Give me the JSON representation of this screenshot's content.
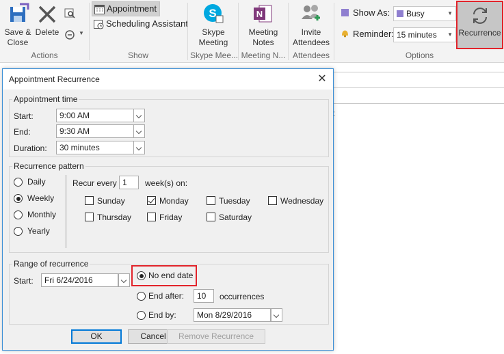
{
  "ribbon": {
    "actions": {
      "save_close": [
        "Save &",
        "Close"
      ],
      "delete": "Delete",
      "group_label": "Actions"
    },
    "show": {
      "appointment": "Appointment",
      "scheduling": "Scheduling Assistant",
      "group_label": "Show"
    },
    "skype": {
      "label": [
        "Skype",
        "Meeting"
      ],
      "group_label": "Skype Mee..."
    },
    "notes": {
      "label": [
        "Meeting",
        "Notes"
      ],
      "group_label": "Meeting N..."
    },
    "attendees": {
      "label": [
        "Invite",
        "Attendees"
      ],
      "group_label": "Attendees"
    },
    "options": {
      "show_as_label": "Show As:",
      "show_as_value": "Busy",
      "reminder_label": "Reminder:",
      "reminder_value": "15 minutes",
      "recurrence": "Recurrence",
      "group_label": "Options"
    }
  },
  "background": {
    "partial_text": "t"
  },
  "dialog": {
    "title": "Appointment Recurrence",
    "appointment_time": {
      "legend": "Appointment time",
      "start_label": "Start:",
      "start_value": "9:00 AM",
      "end_label": "End:",
      "end_value": "9:30 AM",
      "duration_label": "Duration:",
      "duration_value": "30 minutes"
    },
    "pattern": {
      "legend": "Recurrence pattern",
      "options": [
        "Daily",
        "Weekly",
        "Monthly",
        "Yearly"
      ],
      "selected": "Weekly",
      "recur_every_label": "Recur every",
      "recur_every_value": "1",
      "weeks_on_label": "week(s) on:",
      "days": [
        "Sunday",
        "Monday",
        "Tuesday",
        "Wednesday",
        "Thursday",
        "Friday",
        "Saturday"
      ],
      "checked_days": [
        "Monday"
      ]
    },
    "range": {
      "legend": "Range of recurrence",
      "start_label": "Start:",
      "start_value": "Fri 6/24/2016",
      "no_end": "No end date",
      "end_after": "End after:",
      "end_after_value": "10",
      "occurrences": "occurrences",
      "end_by": "End by:",
      "end_by_value": "Mon 8/29/2016",
      "selected": "No end date"
    },
    "buttons": {
      "ok": "OK",
      "cancel": "Cancel",
      "remove": "Remove Recurrence"
    }
  },
  "colors": {
    "highlight": "#e2232a",
    "dialog_border": "#3b8fd6",
    "busy_swatch": "#8f7fd0"
  }
}
